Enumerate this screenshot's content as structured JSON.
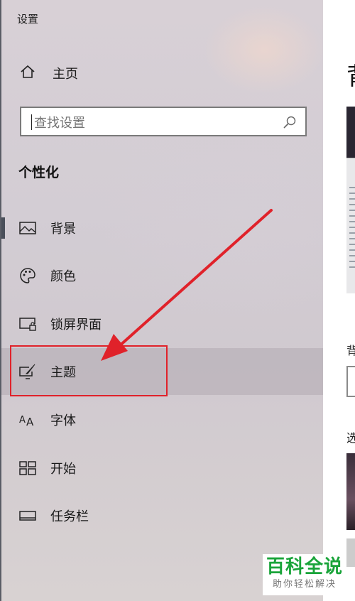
{
  "window": {
    "title": "设置"
  },
  "nav": {
    "home_label": "主页",
    "search_placeholder": "查找设置",
    "section_title": "个性化",
    "items": [
      {
        "label": "背景",
        "icon": "image-icon",
        "selected": true
      },
      {
        "label": "颜色",
        "icon": "palette-icon"
      },
      {
        "label": "锁屏界面",
        "icon": "lock-screen-icon"
      },
      {
        "label": "主题",
        "icon": "theme-brush-icon",
        "highlighted": true
      },
      {
        "label": "字体",
        "icon": "font-icon"
      },
      {
        "label": "开始",
        "icon": "start-grid-icon"
      },
      {
        "label": "任务栏",
        "icon": "taskbar-icon"
      }
    ]
  },
  "content": {
    "heading_partial": "背",
    "background_label_partial": "背",
    "choose_label_partial": "选"
  },
  "annotation": {
    "color": "#e0222a"
  },
  "watermark": {
    "brand": "百科全说",
    "tagline": "助你轻松解决"
  }
}
